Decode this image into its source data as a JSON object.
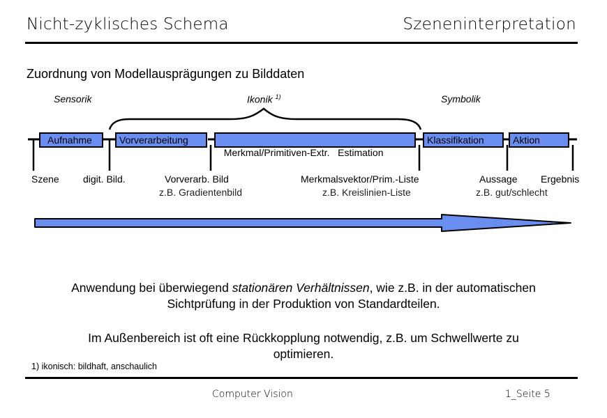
{
  "header": {
    "title_left": "Nicht-zyklisches Schema",
    "title_right": "Szeneninterpretation"
  },
  "subtitle": "Zuordnung von Modellausprägungen zu Bilddaten",
  "categories": {
    "sensorik": "Sensorik",
    "ikonik": "Ikonik",
    "ikonik_footnote": "1)",
    "symbolik": "Symbolik"
  },
  "process_boxes": [
    {
      "label": "Aufnahme"
    },
    {
      "label": "Vorverarbeitung"
    },
    {
      "label": "Merkmal/Primitiven-Extr.   Estimation"
    },
    {
      "label": "Klassifikation"
    },
    {
      "label": "Aktion"
    }
  ],
  "data_labels": [
    {
      "label": "Szene",
      "example": ""
    },
    {
      "label": "digit. Bild.",
      "example": ""
    },
    {
      "label": "Vorverarb. Bild",
      "example": "z.B. Gradientenbild"
    },
    {
      "label": "Merkmalsvektor/Prim.-Liste",
      "example": "z.B. Kreislinien-Liste"
    },
    {
      "label": "Aussage",
      "example": "z.B. gut/schlecht"
    },
    {
      "label": "Ergebnis",
      "example": ""
    }
  ],
  "colors": {
    "box_fill": "#6a8df0",
    "arrow_fill": "#6a8df0",
    "stroke": "#000000"
  },
  "body": {
    "para1_pre": "Anwendung bei überwiegend ",
    "para1_italic": "stationären Verhältnissen",
    "para1_post": ", wie z.B. in der automatischen",
    "para1_line2": "Sichtprüfung in der Produktion von Standardteilen.",
    "para2_line1": "Im Außenbereich ist oft eine Rückkopplung notwendig, z.B. um Schwellwerte zu",
    "para2_line2": "optimieren."
  },
  "footnote": "1) ikonisch: bildhaft, anschaulich",
  "footer": {
    "course": "Computer Vision",
    "page": "1_Seite 5"
  }
}
